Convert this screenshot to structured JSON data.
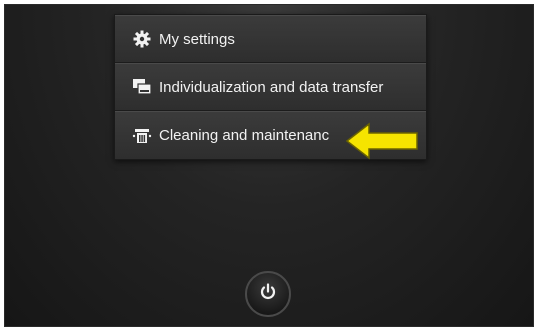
{
  "menu": {
    "items": [
      {
        "label": "My settings",
        "icon": "gear-icon"
      },
      {
        "label": "Individualization and data transfer",
        "icon": "data-transfer-icon"
      },
      {
        "label": "Cleaning and maintenanc",
        "icon": "cleaning-icon"
      }
    ]
  },
  "annotation": {
    "arrow_icon": "arrow-left-icon",
    "arrow_color": "#f5e400"
  },
  "power_button": {
    "icon": "power-icon"
  },
  "colors": {
    "background": "#1e1e1e",
    "menu_text": "#f2f2f2",
    "menu_bg": "#333333"
  }
}
